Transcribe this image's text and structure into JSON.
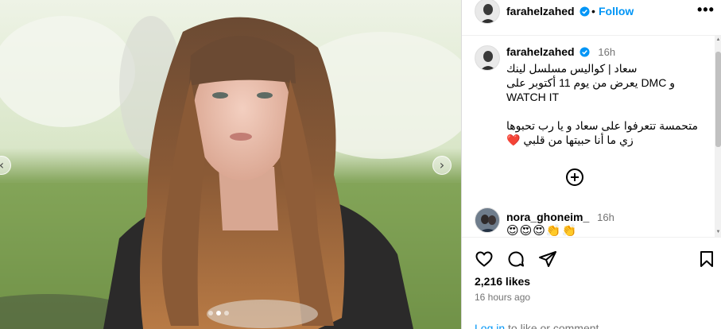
{
  "post": {
    "author": {
      "username": "farahelzahed",
      "follow_separator": "•",
      "follow_label": "Follow",
      "more_label": "•••"
    },
    "caption": {
      "username": "farahelzahed",
      "time": "16h",
      "lines": [
        "سعاد | كواليس مسلسل لينك",
        "و DMC يعرض من يوم 11 أكتوبر على",
        "WATCH IT",
        "متحمسة تتعرفوا على سعاد و يا رب تحبوها",
        "زي ما أنا حبيتها من قلبي"
      ],
      "heart": "❤️"
    },
    "comments": [
      {
        "username": "nora_ghoneim_",
        "time": "16h",
        "text": "😍😍😍👏👏"
      }
    ],
    "likes": "2,216 likes",
    "posted": "16 hours ago",
    "login": {
      "link": "Log in",
      "rest": " to like or comment."
    },
    "carousel": {
      "prev_label": "‹",
      "next_label": "›",
      "slide_count": 3,
      "active_index": 1
    },
    "colors": {
      "accent": "#0095f6",
      "heart": "#e0245e",
      "muted": "#737373"
    },
    "icons": [
      "verified-icon",
      "more-icon",
      "add-circle-icon",
      "heart-icon",
      "comment-icon",
      "share-icon",
      "bookmark-icon"
    ]
  }
}
